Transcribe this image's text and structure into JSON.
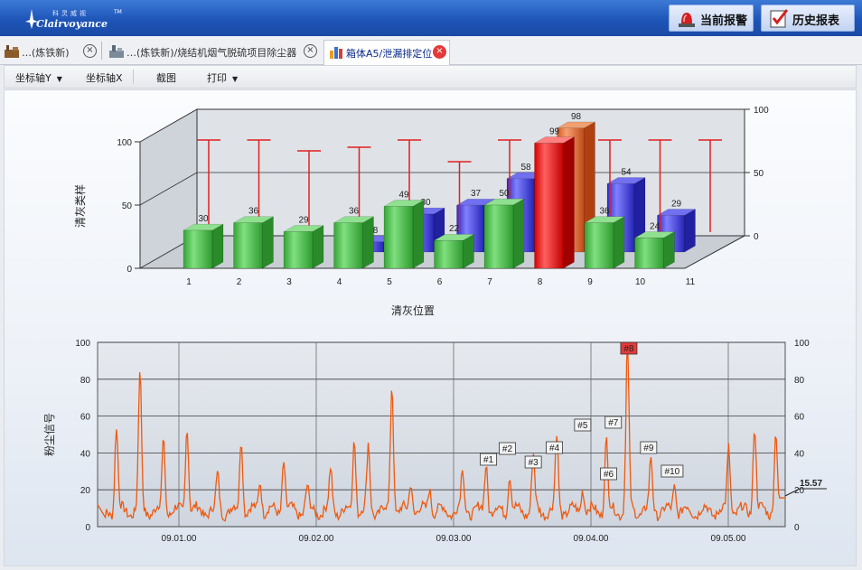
{
  "logo": {
    "name_cn": "科灵威视",
    "name_en": "Clairvoyance",
    "tm": "TM"
  },
  "header": {
    "alarm_label": "当前报警",
    "history_label": "历史报表"
  },
  "tabs": [
    {
      "label": "…(炼铁新)",
      "active": false
    },
    {
      "label": "…(炼铁新)/烧结机烟气脱硫项目除尘器",
      "active": false
    },
    {
      "label": "箱体A5/泄漏排定位",
      "active": true
    }
  ],
  "toolbar": {
    "axis_y": "坐标轴Y",
    "axis_x": "坐标轴X",
    "screenshot": "截图",
    "print": "打印"
  },
  "colors": {
    "green": "#4fbd4f",
    "blue": "#4040e0",
    "red": "#ff1a1a",
    "orange": "#e8703a",
    "line": "#ee5a10",
    "flag": "#e53a3a"
  },
  "bar_chart": {
    "chart_data": {
      "type": "bar",
      "categories": [
        "1",
        "2",
        "3",
        "4",
        "5",
        "6",
        "7",
        "8",
        "9",
        "10",
        "11"
      ],
      "series": [
        {
          "values": [
            30,
            36,
            29,
            36,
            49,
            22,
            50,
            99,
            36,
            24,
            null
          ]
        },
        {
          "values": [
            null,
            null,
            null,
            8,
            30,
            37,
            58,
            98,
            54,
            29,
            null
          ]
        }
      ],
      "thresholds": [
        100,
        100,
        88,
        92,
        100,
        76,
        100,
        100,
        100,
        100,
        100
      ],
      "highlight_category": "8",
      "xlabel": "清灰位置",
      "ylabel": "清灰类样",
      "yticks_left": [
        "0",
        "50",
        "100"
      ],
      "yticks_right": [
        "0",
        "50",
        "100"
      ],
      "ylim": [
        0,
        100
      ]
    }
  },
  "line_chart": {
    "chart_data": {
      "type": "line",
      "xlabel": "",
      "ylabel": "粉尘信号",
      "yticks": [
        "0",
        "20",
        "40",
        "60",
        "80",
        "100"
      ],
      "ylim": [
        0,
        100
      ],
      "xticks": [
        "09.01.00",
        "09.02.00",
        "09.03.00",
        "09.04.00",
        "09.05.00"
      ],
      "peaks": [
        {
          "t": 0.04,
          "v": 54
        },
        {
          "t": 0.09,
          "v": 83
        },
        {
          "t": 0.14,
          "v": 47
        },
        {
          "t": 0.19,
          "v": 57
        },
        {
          "t": 0.255,
          "v": 27
        },
        {
          "t": 0.305,
          "v": 49
        },
        {
          "t": 0.345,
          "v": 26
        },
        {
          "t": 0.395,
          "v": 37
        },
        {
          "t": 0.445,
          "v": 20
        },
        {
          "t": 0.495,
          "v": 30
        },
        {
          "t": 0.545,
          "v": 48
        },
        {
          "t": 0.575,
          "v": 43
        },
        {
          "t": 0.625,
          "v": 79
        },
        {
          "t": 0.665,
          "v": 25
        },
        {
          "t": 0.705,
          "v": 22
        },
        {
          "t": 0.775,
          "v": 30
        },
        {
          "t": 0.825,
          "v": 35
        },
        {
          "t": 0.875,
          "v": 29
        },
        {
          "t": 0.925,
          "v": 37
        },
        {
          "t": 0.975,
          "v": 49
        },
        {
          "t": 1.03,
          "v": 22
        },
        {
          "t": 1.08,
          "v": 47
        },
        {
          "t": 1.125,
          "v": 100
        },
        {
          "t": 1.175,
          "v": 36
        },
        {
          "t": 1.225,
          "v": 23
        },
        {
          "t": 1.34,
          "v": 43
        },
        {
          "t": 1.395,
          "v": 56
        },
        {
          "t": 1.44,
          "v": 51
        }
      ],
      "markers": [
        {
          "label": "#1",
          "t": 0.83
        },
        {
          "label": "#2",
          "t": 0.87
        },
        {
          "label": "#3",
          "t": 0.925
        },
        {
          "label": "#4",
          "t": 0.97
        },
        {
          "label": "#5",
          "t": 1.03
        },
        {
          "label": "#6",
          "t": 1.085
        },
        {
          "label": "#7",
          "t": 1.095
        },
        {
          "label": "#8",
          "t": 1.128
        },
        {
          "label": "#9",
          "t": 1.17
        },
        {
          "label": "#10",
          "t": 1.22
        }
      ],
      "current_value": "15.57",
      "t_range": [
        0,
        1.46
      ]
    }
  }
}
